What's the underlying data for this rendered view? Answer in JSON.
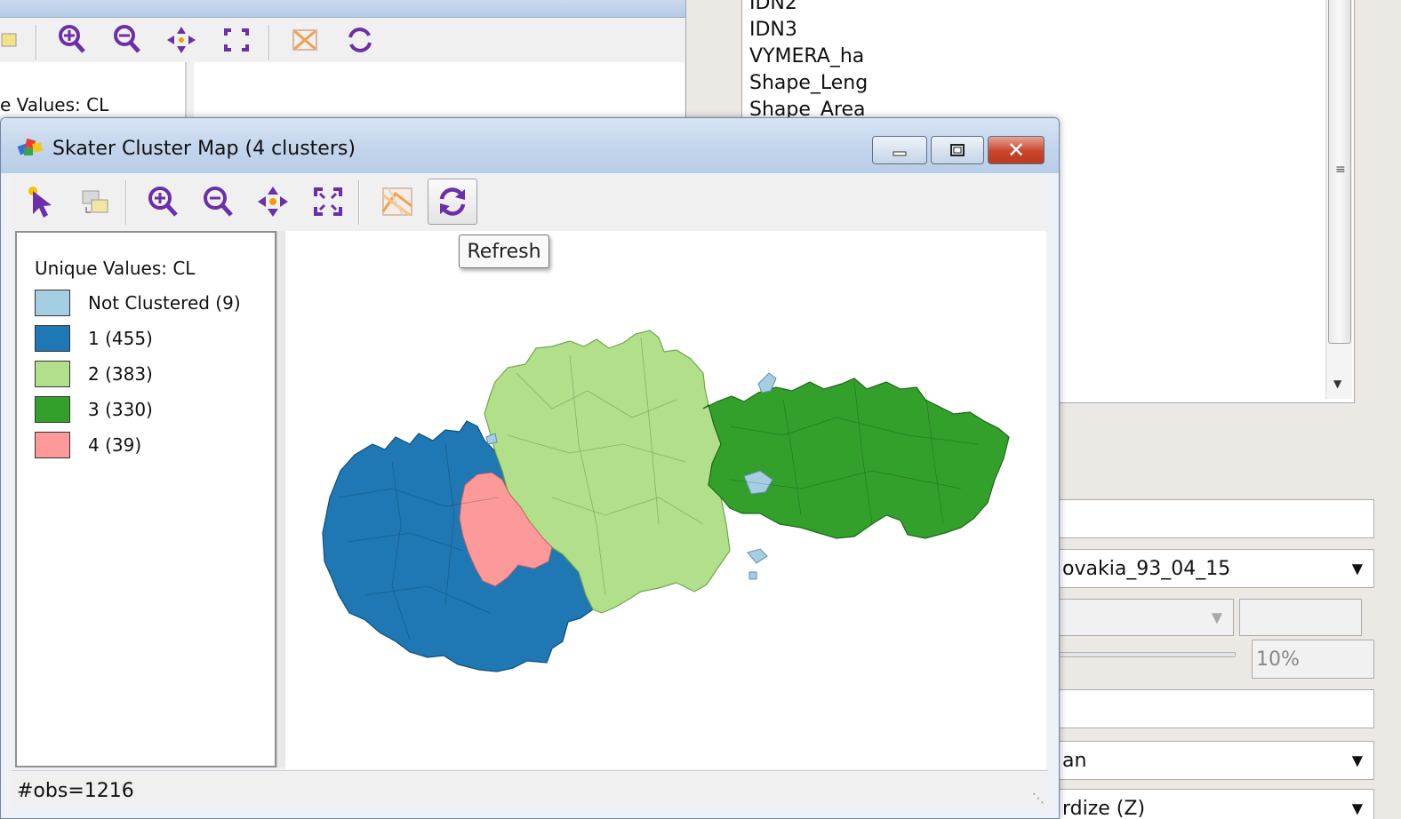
{
  "colors": {
    "not_clustered": "#a6cee3",
    "cluster_1": "#1f78b4",
    "cluster_2": "#b2df8a",
    "cluster_3": "#33a02c",
    "cluster_4": "#fb9a99",
    "accent_purple": "#6b2fa8"
  },
  "background_map_window": {
    "legend_title": "e Values: CL",
    "toolbar_icons": [
      "select-tool-icon",
      "zoom-in-icon",
      "zoom-out-icon",
      "pan-icon",
      "full-extent-icon",
      "selectable-map-icon",
      "refresh-icon"
    ]
  },
  "variable_panel": {
    "variables": [
      "IDN2",
      "IDN3",
      "VYMERA_ha",
      "Shape_Leng",
      "Shape_Area"
    ],
    "weights_combo": "ovakia_93_04_15",
    "percent_field": "10%",
    "distance_combo": "an",
    "transform_combo": "rdize (Z)"
  },
  "window": {
    "title": "Skater Cluster Map (4 clusters)",
    "buttons": [
      "minimize-icon",
      "maximize-icon",
      "close-icon"
    ]
  },
  "toolbar": {
    "tooltip": "Refresh",
    "icons": [
      "select-tool-icon",
      "copy-selection-icon",
      "zoom-in-icon",
      "zoom-out-icon",
      "pan-icon",
      "full-extent-icon",
      "selectable-map-icon",
      "refresh-icon"
    ]
  },
  "legend": {
    "title": "Unique Values: CL",
    "items": [
      {
        "label": "Not Clustered (9)",
        "color": "#a6cee3"
      },
      {
        "label": "1 (455)",
        "color": "#1f78b4"
      },
      {
        "label": "2 (383)",
        "color": "#b2df8a"
      },
      {
        "label": "3 (330)",
        "color": "#33a02c"
      },
      {
        "label": "4 (39)",
        "color": "#fb9a99"
      }
    ]
  },
  "status": {
    "text": "#obs=1216"
  }
}
